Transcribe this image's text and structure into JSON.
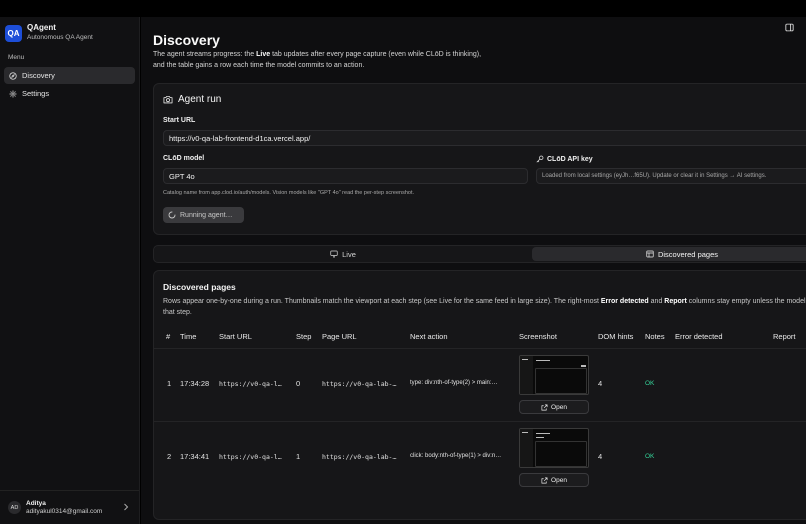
{
  "app": {
    "logo": "QA",
    "name": "QAgent",
    "subtitle": "Autonomous QA Agent"
  },
  "sidebar": {
    "menu_label": "Menu",
    "items": [
      {
        "label": "Discovery",
        "icon": "compass-icon",
        "active": true
      },
      {
        "label": "Settings",
        "icon": "gear-icon",
        "active": false
      }
    ],
    "user": {
      "initials": "AD",
      "name": "Aditya",
      "email": "adityakul0314@gmail.com"
    }
  },
  "page": {
    "title": "Discovery",
    "desc_1": "The agent streams progress: the ",
    "desc_live": "Live",
    "desc_2": " tab updates after every page capture (even while CLōD is thinking), and the table gains a row each time the model commits to an action."
  },
  "agent_run": {
    "title": "Agent run",
    "start_url_label": "Start URL",
    "start_url_value": "https://v0-qa-lab-frontend-d1ca.vercel.app/",
    "model_label": "CLōD model",
    "model_value": "GPT 4o",
    "model_hint": "Catalog name from app.clod.io/auth/models. Vision models like \"GPT 4o\" read the per-step screenshot.",
    "api_key_label": "CLōD API key",
    "api_key_value": "Loaded from local settings (eyJh…f65U). Update or clear it in Settings → AI settings.",
    "run_button": "Running agent…"
  },
  "tabs": [
    {
      "label": "Live",
      "icon": "monitor-icon",
      "active": false
    },
    {
      "label": "Discovered pages",
      "icon": "table-icon",
      "active": true
    }
  ],
  "discovered": {
    "title": "Discovered pages",
    "desc_1": "Rows appear one-by-one during a run. Thumbnails match the viewport at each step (see Live for the same feed in large size). The right-most ",
    "desc_error": "Error detected",
    "desc_2": " and ",
    "desc_report": "Report",
    "desc_3": " columns stay empty unless the model flagged for that step.",
    "columns": [
      "#",
      "Time",
      "Start URL",
      "Step",
      "Page URL",
      "Next action",
      "Screenshot",
      "DOM hints",
      "Notes",
      "Error detected",
      "Report"
    ],
    "rows": [
      {
        "num": "1",
        "time": "17:34:28",
        "start_url": "https://v0-qa-l…",
        "step": "0",
        "page_url": "https://v0-qa-lab-…",
        "next_action": "type: div:nth-of-type(2) > main:…",
        "open": "Open",
        "dom_hints": "4",
        "notes": "OK"
      },
      {
        "num": "2",
        "time": "17:34:41",
        "start_url": "https://v0-qa-l…",
        "step": "1",
        "page_url": "https://v0-qa-lab-…",
        "next_action": "click: body:nth-of-type(1) > div:n…",
        "open": "Open",
        "dom_hints": "4",
        "notes": "OK"
      }
    ]
  },
  "colors": {
    "accent": "#1d4ed8",
    "ok": "#34d399",
    "background": "#0e0e10",
    "card": "#161618"
  }
}
